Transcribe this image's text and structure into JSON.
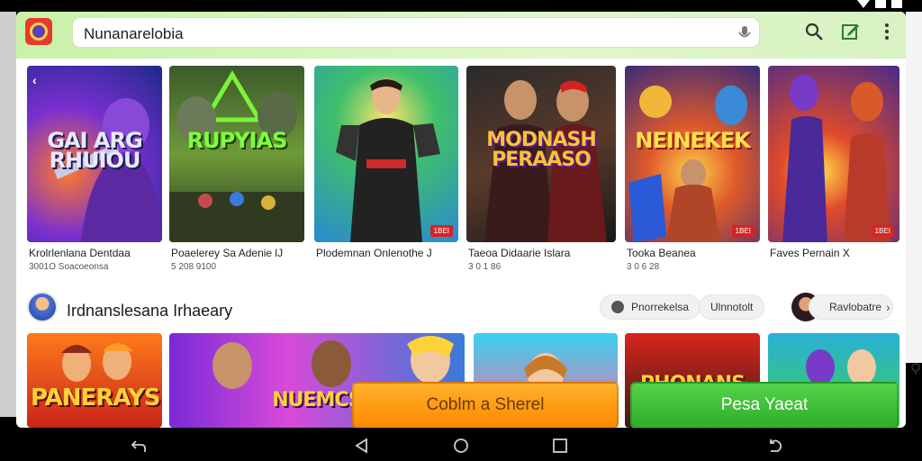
{
  "search": {
    "value": "Nunanarelobia"
  },
  "featured": [
    {
      "logo": "GAI ARG RHUIOU",
      "title": "Krolrlenlana Dentdaa",
      "subtitle": "3001O Soacoeonsa",
      "badge": ""
    },
    {
      "logo": "RUPYIAS",
      "title": "Poaelerey Sa Adenie  lJ",
      "subtitle": "5 208 9100",
      "badge": ""
    },
    {
      "logo": "",
      "title": "Plodemnan Onlenothe J",
      "subtitle": "",
      "badge": "1BEI"
    },
    {
      "logo": "MODNASH PERAASO",
      "title": "Taeoa Didaarie Islara",
      "subtitle": "3 0 1 86",
      "badge": ""
    },
    {
      "logo": "NEINEKEK",
      "title": "Tooka Beanea",
      "subtitle": "3 0 6 28",
      "badge": "1BEI"
    },
    {
      "logo": "",
      "title": "Faves Pernain X",
      "subtitle": "",
      "badge": "1BEI"
    }
  ],
  "section": {
    "title": "Irdnanslesana Irhaeary",
    "chips": [
      "Pnorrekelsa",
      "Ulnnotolt",
      "Ravlobatre"
    ]
  },
  "row2": [
    {
      "logo": "PANERAYS"
    },
    {
      "logo": "NUEMCS"
    },
    {
      "logo": ""
    },
    {
      "logo": ""
    },
    {
      "logo": "PHONANS"
    },
    {
      "logo": ""
    }
  ],
  "actions": {
    "primary": "Coblm a Sherel",
    "secondary": "Pesa Yaeat"
  },
  "colors": {
    "accent_green": "#2fae2a",
    "accent_orange": "#ff8a00",
    "app_bar": "#c9f2a9"
  }
}
